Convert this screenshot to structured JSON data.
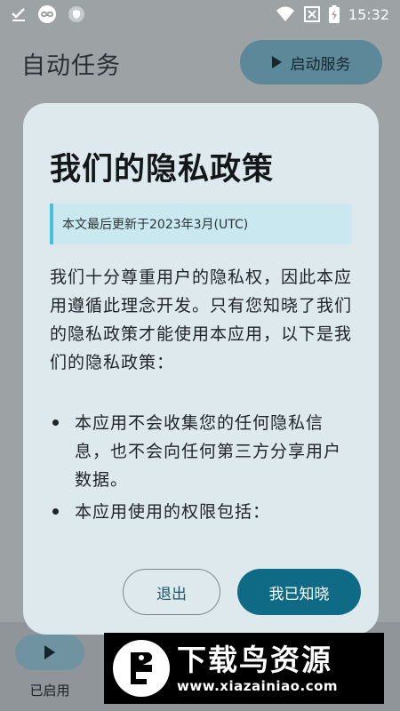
{
  "status_bar": {
    "time": "15:32",
    "left_icons": [
      "check-download-icon",
      "infinity-app-icon",
      "shield-app-icon"
    ],
    "right_icons": [
      "wifi-icon",
      "no-sim-icon",
      "battery-charging-icon"
    ]
  },
  "app_bar": {
    "title": "自动任务",
    "start_service_label": "启动服务"
  },
  "dialog": {
    "title": "我们的隐私政策",
    "updated_notice": "本文最后更新于2023年3月(UTC)",
    "body": "我们十分尊重用户的隐私权，因此本应用遵循此理念开发。只有您知晓了我们的隐私政策才能使用本应用，以下是我们的隐私政策：",
    "bullets": [
      "本应用不会收集您的任何隐私信息，也不会向任何第三方分享用户数据。",
      "本应用使用的权限包括："
    ],
    "exit_label": "退出",
    "ok_label": "我已知晓"
  },
  "bottom_nav": {
    "items": [
      {
        "label": "已启用",
        "icon": "play-icon",
        "selected": true
      }
    ]
  },
  "watermark": {
    "name": "下载鸟资源",
    "url": "www.xiazainiao.com"
  },
  "colors": {
    "accent": "#0e6a85",
    "dialog_bg": "#dde9ec",
    "notice_bar": "#46c2d9",
    "scrim_bg": "#9da2a5"
  }
}
